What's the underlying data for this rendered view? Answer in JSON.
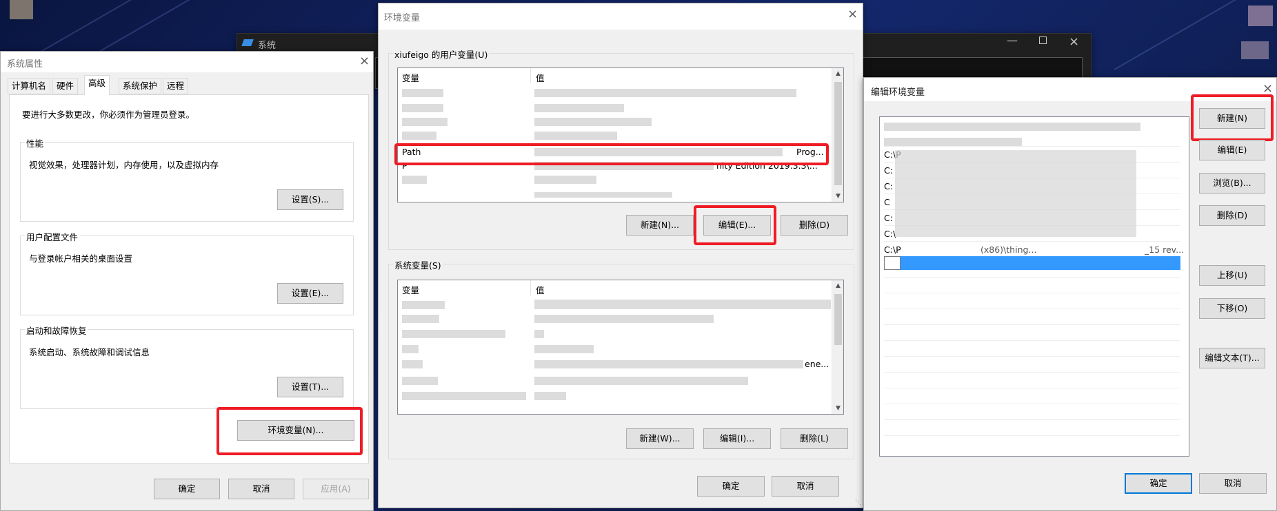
{
  "system_properties": {
    "title": "系统属性",
    "tabs": [
      "计算机名",
      "硬件",
      "高级",
      "系统保护",
      "远程"
    ],
    "admin_note": "要进行大多数更改，你必须作为管理员登录。",
    "groups": [
      {
        "label": "性能",
        "desc": "视觉效果，处理器计划，内存使用，以及虚拟内存",
        "button": "设置(S)..."
      },
      {
        "label": "用户配置文件",
        "desc": "与登录帐户相关的桌面设置",
        "button": "设置(E)..."
      },
      {
        "label": "启动和故障恢复",
        "desc": "系统启动、系统故障和调试信息",
        "button": "设置(T)..."
      }
    ],
    "env_button": "环境变量(N)...",
    "ok": "确定",
    "cancel": "取消",
    "apply": "应用(A)"
  },
  "background_window": {
    "title": "系统"
  },
  "env_vars": {
    "title": "环境变量",
    "user_group_label": "xiufeigo 的用户变量(U)",
    "col_var": "变量",
    "col_val": "值",
    "path_name": "Path",
    "path_value_tail": "Prog...",
    "p_row_name": "P",
    "p_row_value_tail": "nity Edition 2019.3.3\\...",
    "user_new": "新建(N)...",
    "user_edit": "编辑(E)...",
    "user_delete": "删除(D)",
    "system_group_label": "系统变量(S)",
    "sys_partial_value": "ene...",
    "sys_new": "新建(W)...",
    "sys_edit": "编辑(I)...",
    "sys_delete": "删除(L)",
    "ok": "确定",
    "cancel": "取消"
  },
  "edit_env": {
    "title": "编辑环境变量",
    "entries": [
      "C:\\P",
      "C:",
      "C:",
      "C",
      "C:",
      "C:\\",
      "C:\\P"
    ],
    "last_entry_fragment": "(x86)\\thing...",
    "last_entry_tail": "_15 rev...",
    "buttons": {
      "new": "新建(N)",
      "edit": "编辑(E)",
      "browse": "浏览(B)...",
      "delete": "删除(D)",
      "up": "上移(U)",
      "down": "下移(O)",
      "edit_text": "编辑文本(T)..."
    },
    "ok": "确定",
    "cancel": "取消"
  },
  "colors": {
    "highlight": "#ee1c25",
    "selection": "#3399ff",
    "accent": "#0078d7"
  }
}
